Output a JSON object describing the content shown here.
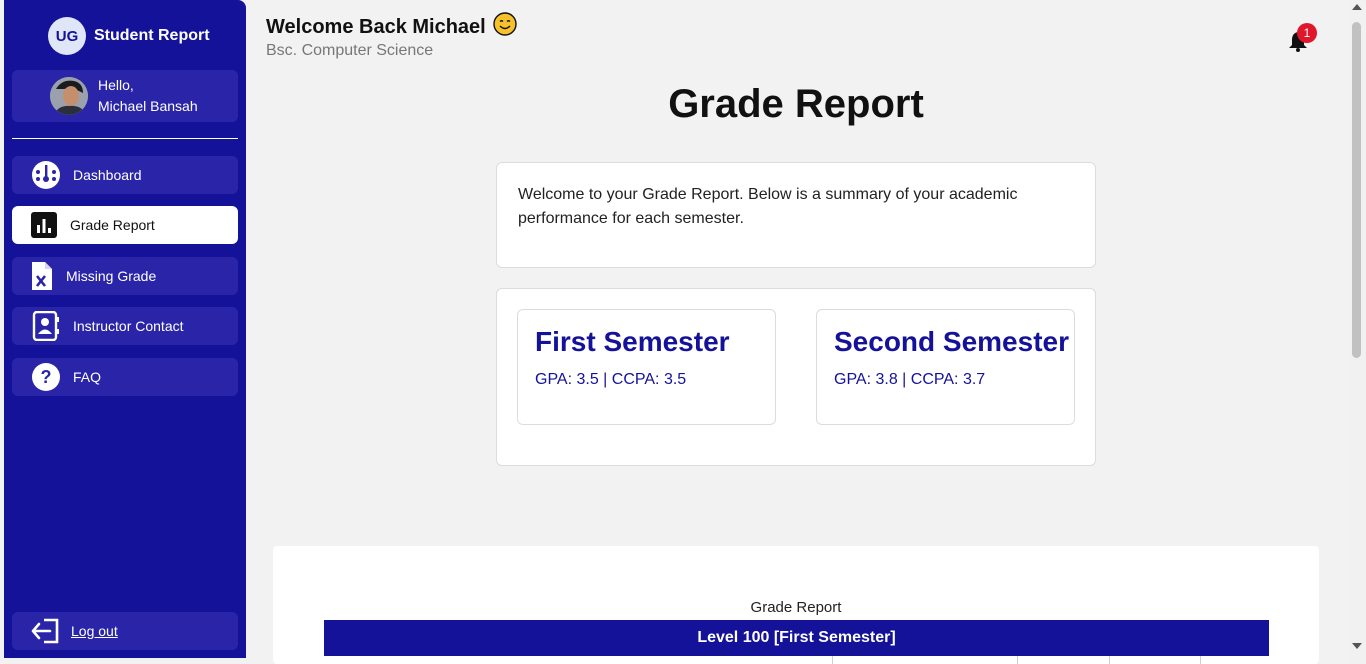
{
  "sidebar": {
    "brand_initials": "UG",
    "brand_title": "Student Report",
    "user_greeting": "Hello,",
    "user_name": "Michael Bansah",
    "items": [
      {
        "label": "Dashboard",
        "icon": "dashboard-gauge-icon",
        "active": false
      },
      {
        "label": "Grade Report",
        "icon": "bar-chart-icon",
        "active": true
      },
      {
        "label": "Missing Grade",
        "icon": "file-x-icon",
        "active": false
      },
      {
        "label": "Instructor Contact",
        "icon": "contact-book-icon",
        "active": false
      },
      {
        "label": "FAQ",
        "icon": "question-circle-icon",
        "active": false
      }
    ],
    "logout_label": "Log out",
    "logout_icon": "logout-arrow-icon"
  },
  "header": {
    "welcome": "Welcome Back Michael",
    "emoji": "😊",
    "program": "Bsc. Computer Science",
    "notification_count": "1",
    "notification_icon": "bell-icon"
  },
  "main": {
    "page_title": "Grade Report",
    "intro_text": "Welcome to your Grade Report. Below is a summary of your academic performance for each semester.",
    "semesters": [
      {
        "title": "First Semester",
        "stats": "GPA: 3.5 | CCPA: 3.5"
      },
      {
        "title": "Second Semester",
        "stats": "GPA: 3.8 | CCPA: 3.7"
      }
    ],
    "report_caption": "Grade Report",
    "level_heading": "Level 100 [First Semester]"
  },
  "colors": {
    "primary": "#15129a",
    "sidebar_item": "#2a25a8",
    "background": "#f2f2f2",
    "badge": "#e0162b"
  }
}
